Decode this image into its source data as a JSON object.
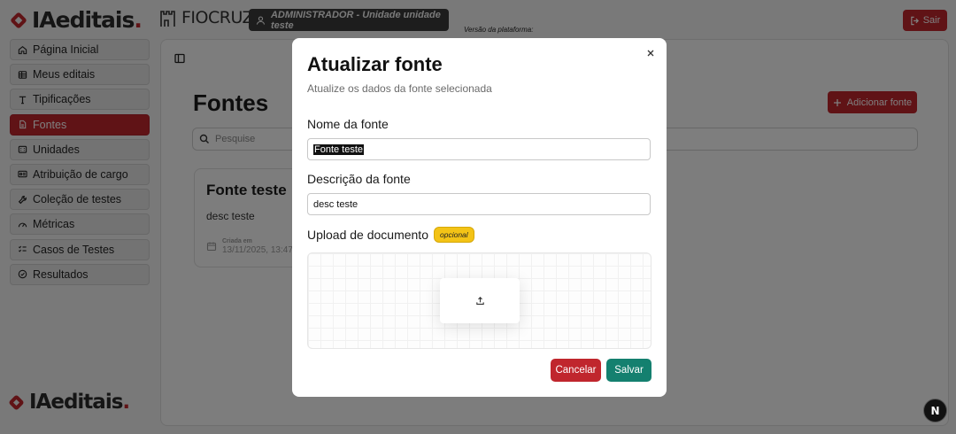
{
  "brand": {
    "name_pre": "IA",
    "name_post": "editais",
    "dot": ".",
    "partner": "FIOCRUZ",
    "accent": "#c0262d"
  },
  "header": {
    "role": "ADMINISTRADOR - Unidade unidade teste",
    "version_label": "Versão da plataforma:",
    "logout_label": "Sair"
  },
  "sidebar": {
    "items": [
      {
        "label": "Página Inicial",
        "icon": "home-icon"
      },
      {
        "label": "Meus editais",
        "icon": "table-icon"
      },
      {
        "label": "Tipificações",
        "icon": "type-icon"
      },
      {
        "label": "Fontes",
        "icon": "file-icon",
        "active": true
      },
      {
        "label": "Unidades",
        "icon": "building-icon"
      },
      {
        "label": "Atribuição de cargo",
        "icon": "id-card-icon"
      },
      {
        "label": "Coleção de testes",
        "icon": "wrench-icon"
      },
      {
        "label": "Métricas",
        "icon": "gauge-icon"
      },
      {
        "label": "Casos de Testes",
        "icon": "list-checks-icon"
      },
      {
        "label": "Resultados",
        "icon": "check-circle-icon"
      }
    ]
  },
  "main": {
    "title": "Fontes",
    "add_label": "Adicionar fonte",
    "search_placeholder": "Pesquise",
    "card": {
      "title": "Fonte teste",
      "description": "desc teste",
      "created_label": "Criada em",
      "created_value": "13/11/2025, 13:47"
    }
  },
  "modal": {
    "title": "Atualizar fonte",
    "subtitle": "Atualize os dados da fonte selecionada",
    "name_label": "Nome da fonte",
    "name_value": "Fonte teste",
    "desc_label": "Descrição da fonte",
    "desc_value": "desc teste",
    "upload_label": "Upload de documento",
    "optional_badge": "opcional",
    "cancel_label": "Cancelar",
    "save_label": "Salvar"
  },
  "floating": {
    "badge_letter": "N"
  }
}
